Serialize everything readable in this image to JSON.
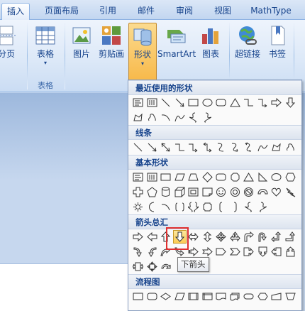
{
  "tabs": [
    {
      "label": "插入",
      "active": true
    },
    {
      "label": "页面布局",
      "active": false
    },
    {
      "label": "引用",
      "active": false
    },
    {
      "label": "邮件",
      "active": false
    },
    {
      "label": "审阅",
      "active": false
    },
    {
      "label": "视图",
      "active": false
    },
    {
      "label": "MathType",
      "active": false
    }
  ],
  "ribbon": {
    "page_label": "分页",
    "table_label": "表格",
    "table_group_label": "表格",
    "picture_label": "图片",
    "clipart_label": "剪贴画",
    "shapes_label": "形状",
    "smartart_label": "SmartArt",
    "chart_label": "图表",
    "hyperlink_label": "超链接",
    "bookmark_label": "书签"
  },
  "shapes_menu": {
    "sections": {
      "recent": "最近使用的形状",
      "lines": "线条",
      "basic": "基本形状",
      "arrows": "箭头总汇",
      "flowchart": "流程图"
    },
    "tooltip": "下箭头"
  },
  "colors": {
    "accent": "#15428b",
    "pressed": "#f8b94a",
    "highlight_border": "#e03030"
  }
}
